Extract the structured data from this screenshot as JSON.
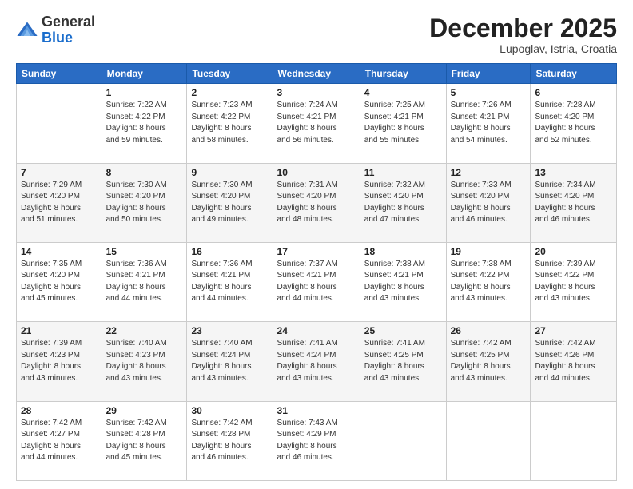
{
  "header": {
    "logo_general": "General",
    "logo_blue": "Blue",
    "month_title": "December 2025",
    "location": "Lupoglav, Istria, Croatia"
  },
  "weekdays": [
    "Sunday",
    "Monday",
    "Tuesday",
    "Wednesday",
    "Thursday",
    "Friday",
    "Saturday"
  ],
  "weeks": [
    [
      {
        "day": "",
        "info": ""
      },
      {
        "day": "1",
        "info": "Sunrise: 7:22 AM\nSunset: 4:22 PM\nDaylight: 8 hours\nand 59 minutes."
      },
      {
        "day": "2",
        "info": "Sunrise: 7:23 AM\nSunset: 4:22 PM\nDaylight: 8 hours\nand 58 minutes."
      },
      {
        "day": "3",
        "info": "Sunrise: 7:24 AM\nSunset: 4:21 PM\nDaylight: 8 hours\nand 56 minutes."
      },
      {
        "day": "4",
        "info": "Sunrise: 7:25 AM\nSunset: 4:21 PM\nDaylight: 8 hours\nand 55 minutes."
      },
      {
        "day": "5",
        "info": "Sunrise: 7:26 AM\nSunset: 4:21 PM\nDaylight: 8 hours\nand 54 minutes."
      },
      {
        "day": "6",
        "info": "Sunrise: 7:28 AM\nSunset: 4:20 PM\nDaylight: 8 hours\nand 52 minutes."
      }
    ],
    [
      {
        "day": "7",
        "info": "Sunrise: 7:29 AM\nSunset: 4:20 PM\nDaylight: 8 hours\nand 51 minutes."
      },
      {
        "day": "8",
        "info": "Sunrise: 7:30 AM\nSunset: 4:20 PM\nDaylight: 8 hours\nand 50 minutes."
      },
      {
        "day": "9",
        "info": "Sunrise: 7:30 AM\nSunset: 4:20 PM\nDaylight: 8 hours\nand 49 minutes."
      },
      {
        "day": "10",
        "info": "Sunrise: 7:31 AM\nSunset: 4:20 PM\nDaylight: 8 hours\nand 48 minutes."
      },
      {
        "day": "11",
        "info": "Sunrise: 7:32 AM\nSunset: 4:20 PM\nDaylight: 8 hours\nand 47 minutes."
      },
      {
        "day": "12",
        "info": "Sunrise: 7:33 AM\nSunset: 4:20 PM\nDaylight: 8 hours\nand 46 minutes."
      },
      {
        "day": "13",
        "info": "Sunrise: 7:34 AM\nSunset: 4:20 PM\nDaylight: 8 hours\nand 46 minutes."
      }
    ],
    [
      {
        "day": "14",
        "info": "Sunrise: 7:35 AM\nSunset: 4:20 PM\nDaylight: 8 hours\nand 45 minutes."
      },
      {
        "day": "15",
        "info": "Sunrise: 7:36 AM\nSunset: 4:21 PM\nDaylight: 8 hours\nand 44 minutes."
      },
      {
        "day": "16",
        "info": "Sunrise: 7:36 AM\nSunset: 4:21 PM\nDaylight: 8 hours\nand 44 minutes."
      },
      {
        "day": "17",
        "info": "Sunrise: 7:37 AM\nSunset: 4:21 PM\nDaylight: 8 hours\nand 44 minutes."
      },
      {
        "day": "18",
        "info": "Sunrise: 7:38 AM\nSunset: 4:21 PM\nDaylight: 8 hours\nand 43 minutes."
      },
      {
        "day": "19",
        "info": "Sunrise: 7:38 AM\nSunset: 4:22 PM\nDaylight: 8 hours\nand 43 minutes."
      },
      {
        "day": "20",
        "info": "Sunrise: 7:39 AM\nSunset: 4:22 PM\nDaylight: 8 hours\nand 43 minutes."
      }
    ],
    [
      {
        "day": "21",
        "info": "Sunrise: 7:39 AM\nSunset: 4:23 PM\nDaylight: 8 hours\nand 43 minutes."
      },
      {
        "day": "22",
        "info": "Sunrise: 7:40 AM\nSunset: 4:23 PM\nDaylight: 8 hours\nand 43 minutes."
      },
      {
        "day": "23",
        "info": "Sunrise: 7:40 AM\nSunset: 4:24 PM\nDaylight: 8 hours\nand 43 minutes."
      },
      {
        "day": "24",
        "info": "Sunrise: 7:41 AM\nSunset: 4:24 PM\nDaylight: 8 hours\nand 43 minutes."
      },
      {
        "day": "25",
        "info": "Sunrise: 7:41 AM\nSunset: 4:25 PM\nDaylight: 8 hours\nand 43 minutes."
      },
      {
        "day": "26",
        "info": "Sunrise: 7:42 AM\nSunset: 4:25 PM\nDaylight: 8 hours\nand 43 minutes."
      },
      {
        "day": "27",
        "info": "Sunrise: 7:42 AM\nSunset: 4:26 PM\nDaylight: 8 hours\nand 44 minutes."
      }
    ],
    [
      {
        "day": "28",
        "info": "Sunrise: 7:42 AM\nSunset: 4:27 PM\nDaylight: 8 hours\nand 44 minutes."
      },
      {
        "day": "29",
        "info": "Sunrise: 7:42 AM\nSunset: 4:28 PM\nDaylight: 8 hours\nand 45 minutes."
      },
      {
        "day": "30",
        "info": "Sunrise: 7:42 AM\nSunset: 4:28 PM\nDaylight: 8 hours\nand 46 minutes."
      },
      {
        "day": "31",
        "info": "Sunrise: 7:43 AM\nSunset: 4:29 PM\nDaylight: 8 hours\nand 46 minutes."
      },
      {
        "day": "",
        "info": ""
      },
      {
        "day": "",
        "info": ""
      },
      {
        "day": "",
        "info": ""
      }
    ]
  ]
}
